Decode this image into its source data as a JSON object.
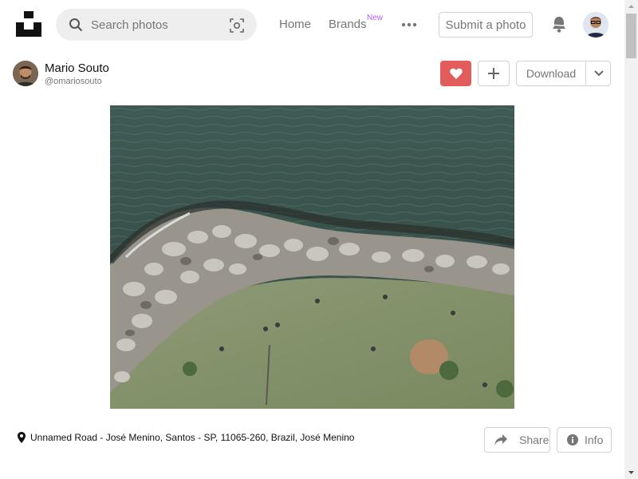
{
  "header": {
    "search": {
      "placeholder": "Search photos"
    },
    "nav": {
      "home": "Home",
      "brands": "Brands",
      "new_badge": "New"
    },
    "submit_label": "Submit a photo"
  },
  "author": {
    "name": "Mario Souto",
    "handle": "@omariosouto"
  },
  "actions": {
    "download_label": "Download"
  },
  "photo": {
    "location": "Unnamed Road - José Menino, Santos - SP, 11065-260, Brazil, José Menino"
  },
  "footer": {
    "share_label": "Share",
    "info_label": "Info"
  },
  "icons": {
    "logo": "unsplash-logo-icon",
    "search": "search-icon",
    "visual_search": "visual-search-icon",
    "more": "more-dots-icon",
    "bell": "bell-icon",
    "heart": "heart-icon",
    "plus": "plus-icon",
    "chevron": "chevron-down-icon",
    "location": "location-pin-icon",
    "share": "share-arrow-icon",
    "info": "info-icon"
  },
  "colors": {
    "like_button": "#e25c5c",
    "new_badge": "#b05bff",
    "muted_text": "#767676"
  }
}
